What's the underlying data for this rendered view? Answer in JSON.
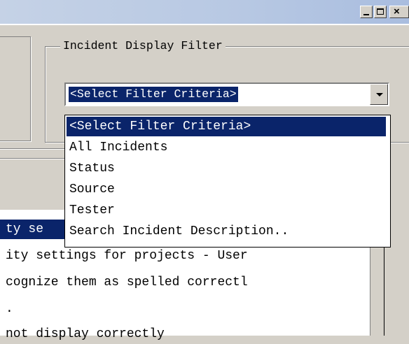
{
  "window": {
    "controls": {
      "minimize_icon": "minimize-icon",
      "maximize_icon": "maximize-icon",
      "close_label": "×"
    }
  },
  "filter_group": {
    "legend": "Incident Display Filter",
    "combo": {
      "selected_value": "<Select Filter Criteria>"
    },
    "dropdown_options": [
      "<Select Filter Criteria>",
      "All Incidents",
      "Status",
      "Source",
      "Tester",
      "Search Incident Description.."
    ],
    "highlighted_index": 0
  },
  "background_text": {
    "lines": [
      "ty se",
      "ity settings for projects - User",
      "cognize them as spelled correctl",
      ".",
      "not display correctly"
    ]
  },
  "colors": {
    "selection": "#0a246a",
    "face": "#d4d0c8",
    "title_gradient_start": "#c5d2e6",
    "title_gradient_end": "#a9bddf"
  }
}
